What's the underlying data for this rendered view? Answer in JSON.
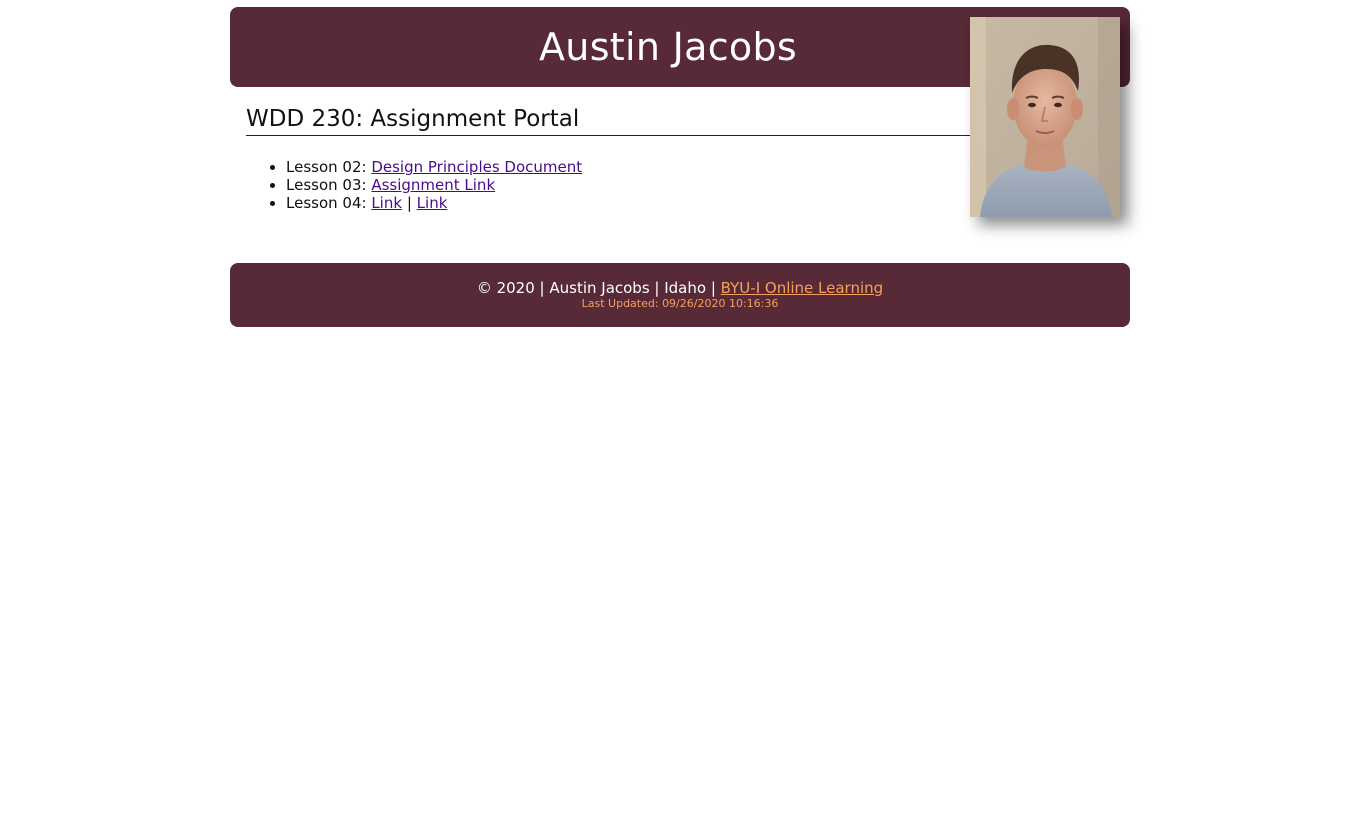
{
  "header": {
    "title": "Austin Jacobs",
    "photo_alt": "Austin Jacobs"
  },
  "main": {
    "heading": "WDD 230: Assignment Portal",
    "lessons": [
      {
        "prefix": "Lesson 02:",
        "links": [
          "Design Principles Document"
        ]
      },
      {
        "prefix": "Lesson 03:",
        "links": [
          "Assignment Link"
        ]
      },
      {
        "prefix": "Lesson 04:",
        "links": [
          "Link",
          "Link"
        ],
        "separator": "|"
      }
    ]
  },
  "footer": {
    "copyright": "© 2020 | Austin Jacobs | Idaho |",
    "link_label": "BYU-I Online Learning",
    "updated_label": "Last Updated:",
    "updated_value": "09/26/2020 10:16:36"
  },
  "colors": {
    "brand": "#582936",
    "accent": "#f4a15d",
    "link": "#4b0a8c"
  }
}
